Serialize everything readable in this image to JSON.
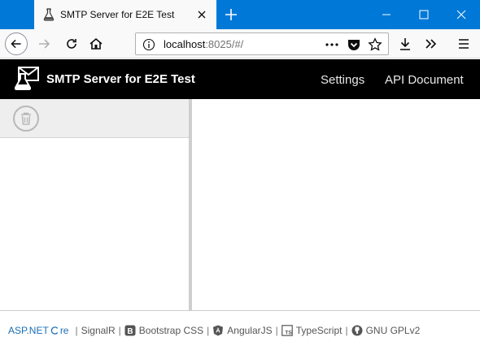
{
  "browser": {
    "tab_title": "SMTP Server for E2E Test",
    "url_host": "localhost",
    "url_rest": ":8025/#/"
  },
  "app": {
    "title": "SMTP Server for E2E Test",
    "nav": {
      "settings": "Settings",
      "api_document": "API Document"
    }
  },
  "footer": {
    "aspnet": "ASP.NET",
    "core": "re",
    "separator": "|",
    "links": {
      "signalr": "SignalR",
      "bootstrap": "Bootstrap CSS",
      "angularjs": "AngularJS",
      "typescript": "TypeScript",
      "gnu": "GNU GPLv2"
    }
  },
  "icons": {
    "tab_favicon": "flask-icon",
    "logo": "flask-mail-logo",
    "trash": "trash-icon",
    "bootstrap": "bootstrap-icon",
    "angular": "angular-icon",
    "typescript": "typescript-icon",
    "github": "github-icon"
  },
  "colors": {
    "titlebar": "#0078d7",
    "app_header": "#000000",
    "footer_link": "#555555",
    "aspnet_blue": "#1a6fb5"
  }
}
